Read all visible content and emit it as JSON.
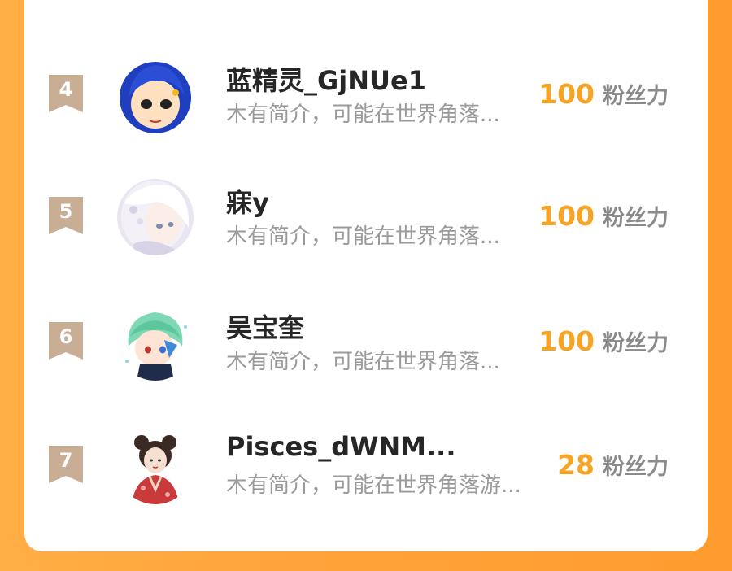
{
  "colors": {
    "background": "#ffa238",
    "card": "#ffffff",
    "score": "#f7a324",
    "rank_badge": "#c9ae96"
  },
  "fans_unit": "粉丝力",
  "rows": [
    {
      "rank": "4",
      "name": "蓝精灵_GjNUe1",
      "bio": "木有简介，可能在世界角落...",
      "score": "100",
      "avatar_icon": "blue-hair-cartoon-avatar-icon"
    },
    {
      "rank": "5",
      "name": "寐y",
      "bio": "木有简介，可能在世界角落...",
      "score": "100",
      "avatar_icon": "white-hair-anime-avatar-icon"
    },
    {
      "rank": "6",
      "name": "吴宝奎",
      "bio": "木有简介，可能在世界角落...",
      "score": "100",
      "avatar_icon": "green-hair-chibi-avatar-icon"
    },
    {
      "rank": "7",
      "name": "Pisces_dWNM...",
      "bio": "木有简介，可能在世界角落游...",
      "score": "28",
      "avatar_icon": "kimono-girl-avatar-icon"
    }
  ]
}
